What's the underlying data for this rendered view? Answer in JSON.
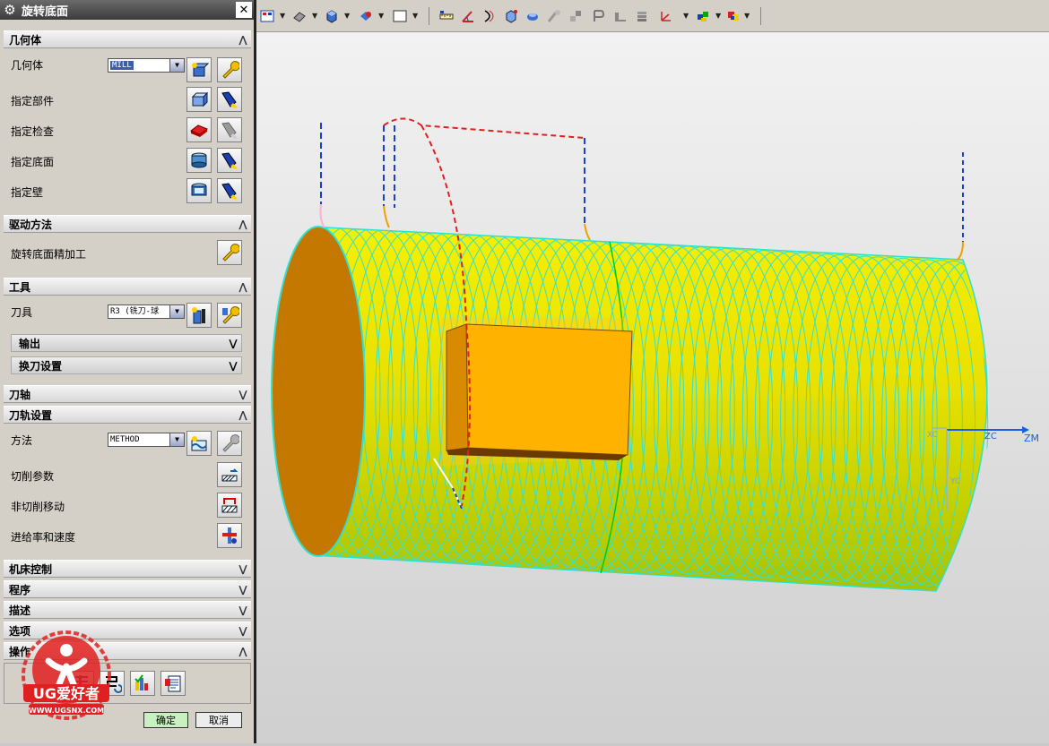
{
  "dialog": {
    "title": "旋转底面",
    "sections": {
      "geometry": {
        "title": "几何体",
        "geometry_label": "几何体",
        "geometry_value": "MILL",
        "part_label": "指定部件",
        "check_label": "指定检查",
        "floor_label": "指定底面",
        "wall_label": "指定壁"
      },
      "drive": {
        "title": "驱动方法",
        "method_label": "旋转底面精加工"
      },
      "tool": {
        "title": "工具",
        "tool_label": "刀具",
        "tool_value": "R3 (铣刀-球",
        "output_label": "输出",
        "toolchange_label": "换刀设置"
      },
      "axis": {
        "title": "刀轴"
      },
      "path": {
        "title": "刀轨设置",
        "method_label": "方法",
        "method_value": "METHOD",
        "cut_params_label": "切削参数",
        "non_cut_label": "非切削移动",
        "feeds_label": "进给率和速度"
      },
      "machine": {
        "title": "机床控制"
      },
      "program": {
        "title": "程序"
      },
      "description": {
        "title": "描述"
      },
      "options": {
        "title": "选项"
      },
      "actions": {
        "title": "操作"
      }
    },
    "ok_label": "确定",
    "cancel_label": "取消"
  },
  "logo": {
    "text": "UG爱好者",
    "url": "WWW.UGSNX.COM"
  },
  "viewport": {
    "axis_labels": {
      "zm": "ZM",
      "zc": "ZC",
      "xc": "XC",
      "yc": "YC"
    }
  },
  "colors": {
    "part_body": "#f0e000",
    "floor_face": "#c47800",
    "pocket": "#ffb300",
    "toolpath": "#37e0d0",
    "accent": "#3a5fa8"
  }
}
